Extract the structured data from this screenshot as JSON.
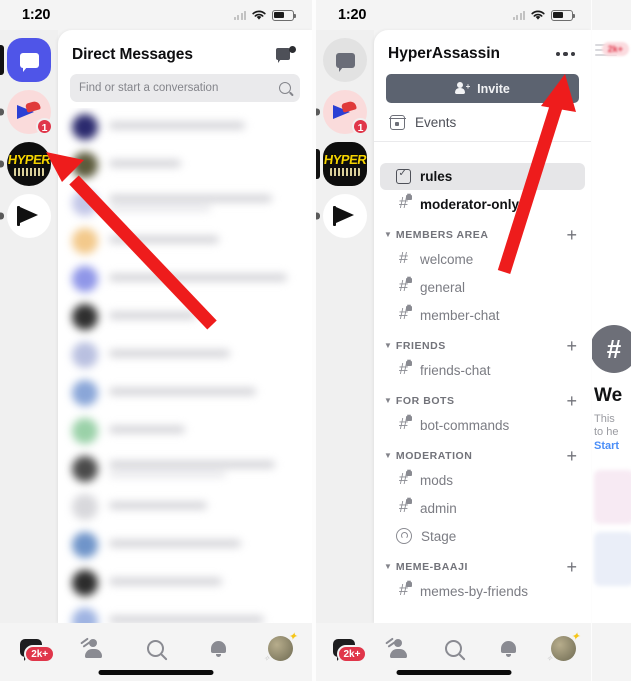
{
  "meta": {
    "app": "Discord Mobile",
    "description": "Two side-by-side mobile screenshots with red annotation arrows"
  },
  "status_bar": {
    "time": "1:20",
    "signal_icon": "signal-bars-icon",
    "wifi_icon": "wifi-icon",
    "battery_icon": "battery-icon"
  },
  "left_phone": {
    "server_rail": [
      {
        "name": "direct-messages",
        "label": "DM",
        "icon": "discord-chat-icon",
        "state": "active",
        "badge": ""
      },
      {
        "name": "server-plane",
        "label": "",
        "icon": "server-avatar-plane",
        "state": "inactive",
        "badge": "1"
      },
      {
        "name": "server-hyper",
        "label": "HYPER",
        "icon": "server-avatar-hyper",
        "state": "inactive",
        "badge": ""
      },
      {
        "name": "server-flag",
        "label": "",
        "icon": "server-avatar-flag",
        "state": "inactive",
        "badge": ""
      }
    ],
    "header": {
      "title": "Direct Messages",
      "new_dm_icon": "new-direct-message-icon"
    },
    "search": {
      "placeholder": "Find or start a conversation",
      "icon": "search-icon"
    },
    "dm_list_blurred_rows": 14
  },
  "right_phone": {
    "server_rail": [
      {
        "name": "direct-messages",
        "label": "DM",
        "icon": "discord-chat-icon",
        "state": "inactive",
        "badge": ""
      },
      {
        "name": "server-plane",
        "label": "",
        "icon": "server-avatar-plane",
        "state": "inactive",
        "badge": "1"
      },
      {
        "name": "server-hyper",
        "label": "HYPER",
        "icon": "server-avatar-hyper",
        "state": "active",
        "badge": ""
      },
      {
        "name": "server-flag",
        "label": "",
        "icon": "server-avatar-flag",
        "state": "inactive",
        "badge": ""
      }
    ],
    "header": {
      "server_name": "HyperAssassin",
      "more_options_icon": "three-dots-icon"
    },
    "invite_button": {
      "label": "Invite",
      "icon": "person-add-icon"
    },
    "events_row": {
      "label": "Events",
      "icon": "calendar-icon"
    },
    "top_channels": [
      {
        "name": "rules",
        "label": "rules",
        "icon": "rules-icon",
        "selected": true,
        "locked": false
      },
      {
        "name": "moderator-only",
        "label": "moderator-only",
        "icon": "hash-locked-icon",
        "selected": false,
        "locked": true,
        "strong": true
      }
    ],
    "categories": [
      {
        "name": "members-area",
        "label": "MEMBERS AREA",
        "add_icon": "plus-icon",
        "collapse_icon": "chevron-down-icon",
        "channels": [
          {
            "name": "welcome",
            "label": "welcome",
            "icon": "hash-icon",
            "locked": false
          },
          {
            "name": "general",
            "label": "general",
            "icon": "hash-locked-icon",
            "locked": true
          },
          {
            "name": "member-chat",
            "label": "member-chat",
            "icon": "hash-locked-icon",
            "locked": true
          }
        ]
      },
      {
        "name": "friends",
        "label": "FRIENDS",
        "add_icon": "plus-icon",
        "collapse_icon": "chevron-down-icon",
        "channels": [
          {
            "name": "friends-chat",
            "label": "friends-chat",
            "icon": "hash-locked-icon",
            "locked": true
          }
        ]
      },
      {
        "name": "for-bots",
        "label": "FOR BOTS",
        "add_icon": "plus-icon",
        "collapse_icon": "chevron-down-icon",
        "channels": [
          {
            "name": "bot-commands",
            "label": "bot-commands",
            "icon": "hash-locked-icon",
            "locked": true
          }
        ]
      },
      {
        "name": "moderation",
        "label": "MODERATION",
        "add_icon": "plus-icon",
        "collapse_icon": "chevron-down-icon",
        "channels": [
          {
            "name": "mods",
            "label": "mods",
            "icon": "hash-locked-icon",
            "locked": true
          },
          {
            "name": "admin",
            "label": "admin",
            "icon": "hash-locked-icon",
            "locked": true
          },
          {
            "name": "stage",
            "label": "Stage",
            "icon": "stage-channel-icon",
            "locked": false
          }
        ]
      },
      {
        "name": "meme-baaji",
        "label": "MEME-BAAJI",
        "add_icon": "plus-icon",
        "collapse_icon": "chevron-down-icon",
        "channels": [
          {
            "name": "memes-by-friends",
            "label": "memes-by-friends",
            "icon": "hash-locked-icon",
            "locked": true
          }
        ]
      }
    ]
  },
  "chat_preview": {
    "hash_glyph": "#",
    "heading": "We",
    "line1": "This",
    "line2": "to he",
    "link": "Start",
    "badge": "2k+"
  },
  "bottom_nav": {
    "items": [
      {
        "name": "nav-messages",
        "icon": "chat-bubble-icon",
        "badge": "2k+",
        "active": true
      },
      {
        "name": "nav-friends",
        "icon": "friends-icon",
        "badge": "",
        "active": false
      },
      {
        "name": "nav-search",
        "icon": "search-icon",
        "badge": "",
        "active": false
      },
      {
        "name": "nav-notifications",
        "icon": "bell-icon",
        "badge": "",
        "active": false
      },
      {
        "name": "nav-profile",
        "icon": "user-avatar-icon",
        "badge": "",
        "active": false
      }
    ]
  },
  "annotations": {
    "arrow_color": "#ee1c1c",
    "left_arrow_target": "server-hyper",
    "right_arrow_target": "three-dots-icon"
  },
  "colors": {
    "accent": "#4f55e8",
    "badge_red": "#e0364a",
    "arrow_red": "#ee1c1c",
    "invite_bg": "#5c6370",
    "selected_bg": "#e6e6e8"
  }
}
